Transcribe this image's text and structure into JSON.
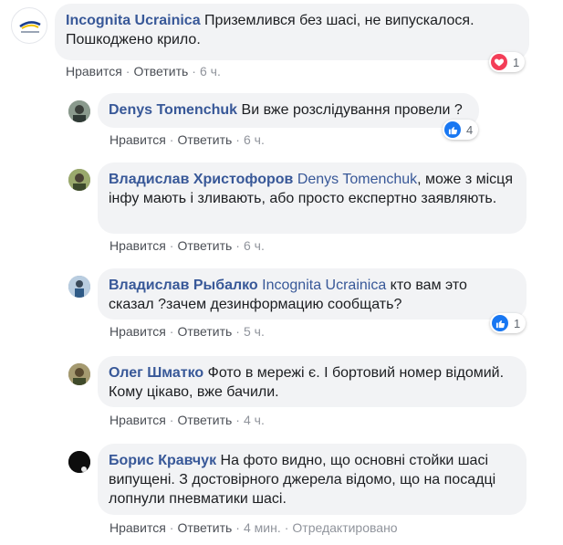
{
  "colors": {
    "author": "#385898",
    "bubble": "#f2f3f5",
    "love": "#f33e58",
    "like": "#1877f2"
  },
  "comments": [
    {
      "author": "Incognita Ucrainica",
      "mention": "",
      "text": "Приземлився без шасі, не випускалося. Пошкоджено крило.",
      "actions": {
        "like": "Нравится",
        "reply": "Ответить",
        "time": "6 ч."
      },
      "reaction": {
        "icon": "heart-icon",
        "count": "1"
      }
    },
    {
      "author": "Denys Tomenchuk",
      "mention": "",
      "text": "Ви вже розслідування провели ?",
      "actions": {
        "like": "Нравится",
        "reply": "Ответить",
        "time": "6 ч."
      },
      "reaction": {
        "icon": "thumbs-up-icon",
        "count": "4"
      }
    },
    {
      "author": "Владислав Христофоров",
      "mention": "Denys Tomenchuk",
      "text": ", може з місця інфу мають і зливають, або просто експертно заявляють.",
      "actions": {
        "like": "Нравится",
        "reply": "Ответить",
        "time": "6 ч."
      }
    },
    {
      "author": "Владислав Рыбалко",
      "mention": "Incognita Ucrainica",
      "text": " кто вам это сказал ?зачем дезинформацию сообщать?",
      "actions": {
        "like": "Нравится",
        "reply": "Ответить",
        "time": "5 ч."
      },
      "reaction": {
        "icon": "thumbs-up-icon",
        "count": "1"
      }
    },
    {
      "author": "Олег Шматко",
      "mention": "",
      "text": "Фото в мережі є. І бортовий номер відомий. Кому цікаво, вже бачили.",
      "actions": {
        "like": "Нравится",
        "reply": "Ответить",
        "time": "4 ч."
      }
    },
    {
      "author": "Борис Кравчук",
      "mention": "",
      "text": "На фото видно, що основні стойки шасі випущені. З достовірного джерела відомо, що на посадці лопнули пневматики шасі.",
      "actions": {
        "like": "Нравится",
        "reply": "Ответить",
        "time": "4 мин.",
        "edited": "Отредактировано"
      }
    }
  ]
}
